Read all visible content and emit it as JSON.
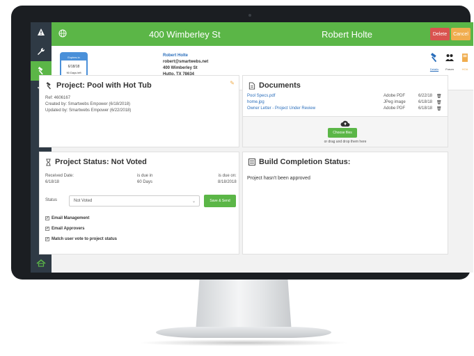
{
  "header": {
    "address": "400 Wimberley St",
    "client_name": "Robert Holte",
    "delete_label": "Delete",
    "cancel_label": "Cancel"
  },
  "sidebar": {
    "items": [
      {
        "icon": "warning-icon"
      },
      {
        "icon": "wrench-icon"
      },
      {
        "icon": "hammer-icon"
      },
      {
        "icon": "cart-icon"
      }
    ],
    "bottom_icon": "home-icon"
  },
  "calendar": {
    "header": "Expires in",
    "date": "6/18/18",
    "left": "90 Days left"
  },
  "contact": {
    "name": "Robert Holte",
    "email": "robert@smartwebs.net",
    "street": "400 Wimberley St",
    "city": "Hutto, TX 78634"
  },
  "top_icons": [
    {
      "icon": "hammer-icon",
      "label": "Details"
    },
    {
      "icon": "people-icon",
      "label": "Forum"
    },
    {
      "icon": "notebook-icon",
      "label": "HOA"
    }
  ],
  "project": {
    "title": "Project: Pool with Hot Tub",
    "ref": "Ref: 4606167",
    "created": "Created by: Smartwebs Empower (6/18/2018)",
    "updated": "Updated by: Smartwebs Empower (6/22/2018)"
  },
  "documents": {
    "title": "Documents",
    "rows": [
      {
        "name": "Pool Specs.pdf",
        "type": "Adobe PDF",
        "date": "6/22/18"
      },
      {
        "name": "home.jpg",
        "type": "JPeg image",
        "date": "6/18/18"
      },
      {
        "name": "Owner Letter - Project Under Review",
        "type": "Adobe PDF",
        "date": "6/18/18"
      }
    ],
    "choose_label": "Choose files",
    "drop_note": "or drag and drop them here"
  },
  "status": {
    "title": "Project Status: Not Voted",
    "received_label": "Received Date:",
    "received_value": "6/18/18",
    "duein_label": "is due in",
    "duein_value": "60 Days",
    "dueon_label": "is due on:",
    "dueon_value": "8/18/2018",
    "status_label": "Status",
    "status_value": "Not Voted",
    "save_label": "Save & Send",
    "checks": [
      {
        "label": "Email Management",
        "checked": true
      },
      {
        "label": "Email Approvers",
        "checked": true
      },
      {
        "label": "Match user vote to project status",
        "checked": true
      }
    ]
  },
  "build": {
    "title": "Build Completion Status:",
    "text": "Project hasn't been approved"
  },
  "colors": {
    "accent_green": "#5bb647",
    "sidebar": "#2f3a45",
    "delete_red": "#d9534f",
    "cancel_orange": "#f0ad4e",
    "link_blue": "#2a6ebb"
  }
}
